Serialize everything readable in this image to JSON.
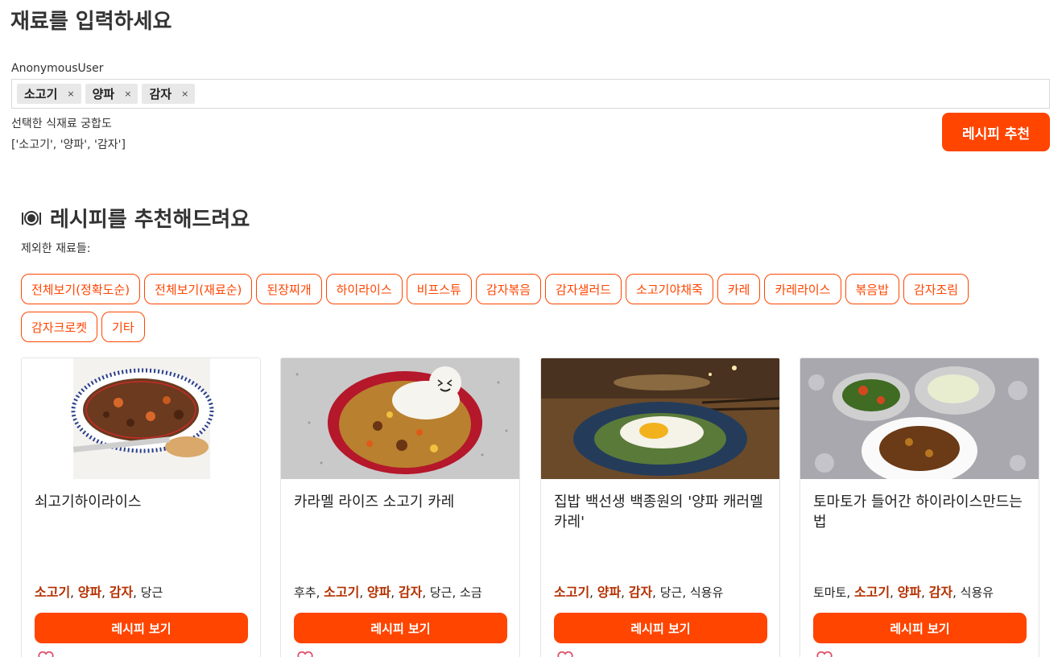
{
  "header": {
    "title": "재료를 입력하세요",
    "user": "AnonymousUser"
  },
  "input": {
    "chips": [
      {
        "label": "소고기",
        "remove": "×"
      },
      {
        "label": "양파",
        "remove": "×"
      },
      {
        "label": "감자",
        "remove": "×"
      }
    ]
  },
  "compat": {
    "title": "선택한 식재료 궁합도",
    "list": "['소고기', '양파', '감자']"
  },
  "recommend_button": "레시피 추천",
  "section": {
    "title": "레시피를 추천해드려요",
    "excluded_label": "제외한 재료들:"
  },
  "filters": [
    "전체보기(정확도순)",
    "전체보기(재료순)",
    "된장찌개",
    "하이라이스",
    "비프스튜",
    "감자볶음",
    "감자샐러드",
    "소고기야채죽",
    "카레",
    "카레라이스",
    "볶음밥",
    "감자조림",
    "감자크로켓",
    "기타"
  ],
  "cards": [
    {
      "title": "쇠고기하이라이스",
      "ingredients": [
        {
          "name": "소고기",
          "hl": true
        },
        {
          "name": "양파",
          "hl": true
        },
        {
          "name": "감자",
          "hl": true
        },
        {
          "name": "당근",
          "hl": false
        }
      ],
      "button": "레시피 보기"
    },
    {
      "title": "카라멜 라이즈 소고기 카레",
      "ingredients": [
        {
          "name": "후추",
          "hl": false
        },
        {
          "name": "소고기",
          "hl": true
        },
        {
          "name": "양파",
          "hl": true
        },
        {
          "name": "감자",
          "hl": true
        },
        {
          "name": "당근",
          "hl": false
        },
        {
          "name": "소금",
          "hl": false
        }
      ],
      "button": "레시피 보기"
    },
    {
      "title": "집밥 백선생 백종원의 '양파 캐러멜 카레'",
      "ingredients": [
        {
          "name": "소고기",
          "hl": true
        },
        {
          "name": "양파",
          "hl": true
        },
        {
          "name": "감자",
          "hl": true
        },
        {
          "name": "당근",
          "hl": false
        },
        {
          "name": "식용유",
          "hl": false
        }
      ],
      "button": "레시피 보기"
    },
    {
      "title": "토마토가 들어간 하이라이스만드는 법",
      "ingredients": [
        {
          "name": "토마토",
          "hl": false
        },
        {
          "name": "소고기",
          "hl": true
        },
        {
          "name": "양파",
          "hl": true
        },
        {
          "name": "감자",
          "hl": true
        },
        {
          "name": "식용유",
          "hl": false
        }
      ],
      "button": "레시피 보기"
    }
  ],
  "colors": {
    "accent": "#ff4500",
    "highlight": "#b33000",
    "heart": "#e0506a"
  }
}
